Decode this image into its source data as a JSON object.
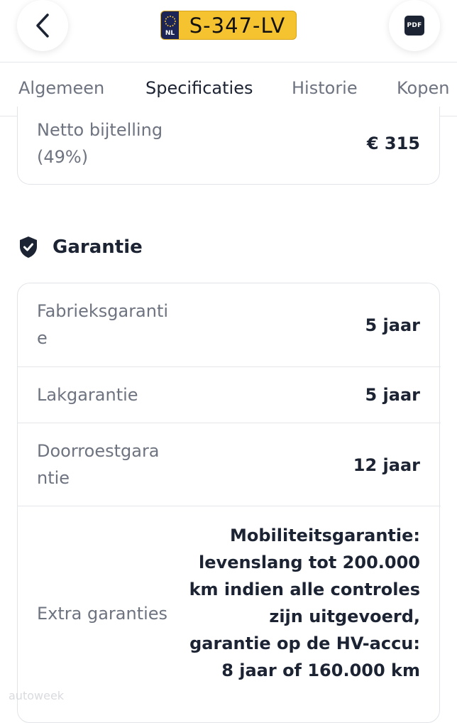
{
  "header": {
    "license_plate": "S-347-LV",
    "plate_country": "NL",
    "pdf_label": "PDF"
  },
  "tabs": [
    {
      "label": "Algemeen",
      "active": false
    },
    {
      "label": "Specificaties",
      "active": true
    },
    {
      "label": "Historie",
      "active": false
    },
    {
      "label": "Kopen",
      "active": false
    }
  ],
  "top_card": {
    "label": "Netto bijtelling (49%)",
    "value": "€ 315"
  },
  "warranty": {
    "title": "Garantie",
    "rows": [
      {
        "label": "Fabrieksgaranti\ne",
        "value": "5 jaar"
      },
      {
        "label": "Lakgarantie",
        "value": "5 jaar"
      },
      {
        "label": "Doorroestgara\nntie",
        "value": "12 jaar"
      },
      {
        "label": "Extra garanties",
        "value": "Mobiliteitsgarantie: levenslang tot 200.000 km indien alle controles zijn uitgevoerd, garantie op de HV-accu: 8 jaar of 160.000 km"
      }
    ]
  },
  "watermark": "autoweek",
  "colors": {
    "accent": "#3c6fd6",
    "plate_yellow": "#f5c230",
    "plate_blue": "#1c2555",
    "text_dark": "#1c2333",
    "text_muted": "#6e7380"
  }
}
